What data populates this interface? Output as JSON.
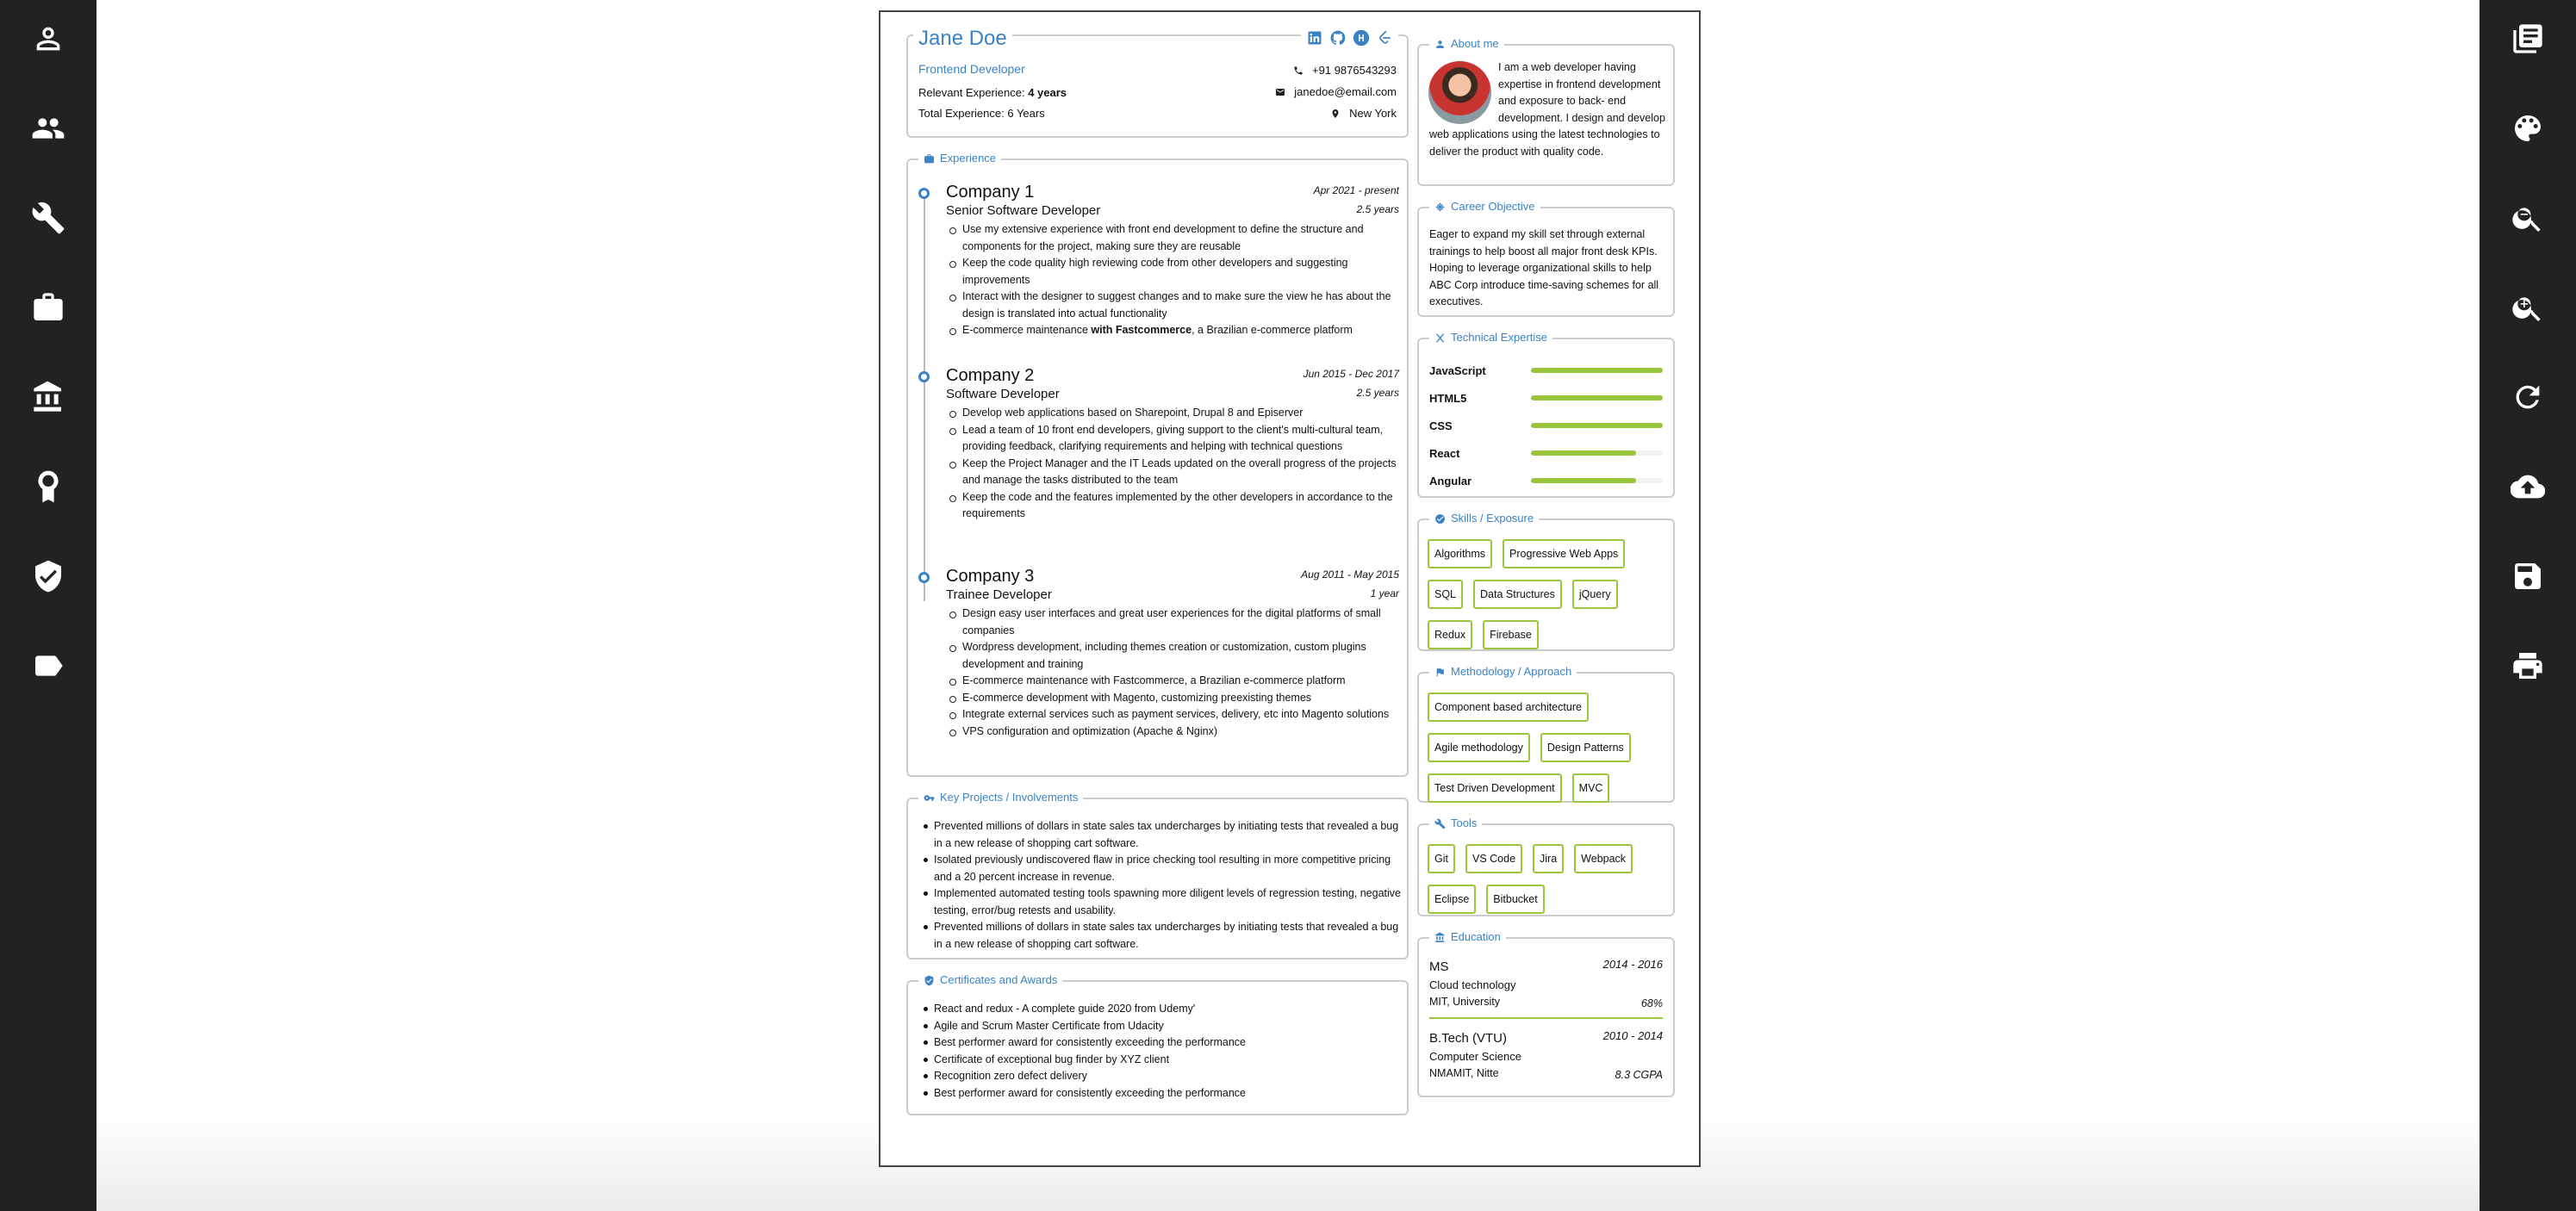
{
  "sidebar_left": {
    "items": [
      "person-icon",
      "people-icon",
      "wrench-icon",
      "briefcase-icon",
      "bank-icon",
      "award-icon",
      "shield-icon",
      "tag-icon"
    ]
  },
  "sidebar_right": {
    "items": [
      "library-icon",
      "palette-icon",
      "zoom-out-icon",
      "zoom-in-icon",
      "refresh-icon",
      "cloud-upload-icon",
      "save-icon",
      "print-icon"
    ]
  },
  "header": {
    "name": "Jane Doe",
    "role": "Frontend Developer",
    "relevant_label": "Relevant Experience: ",
    "relevant_value": "4 years",
    "total": "Total Experience: 6 Years",
    "phone": "+91 9876543293",
    "email": "janedoe@email.com",
    "location": "New York",
    "social": [
      "linkedin-icon",
      "github-icon",
      "hackerrank-icon",
      "leetcode-icon"
    ]
  },
  "experience": {
    "title": "Experience",
    "companies": [
      {
        "name": "Company 1",
        "position": "Senior Software Developer",
        "date": "Apr 2021 - present",
        "duration": "2.5 years",
        "points": [
          "Use my extensive experience with front end development to define the structure and components for the project, making sure they are reusable",
          "Keep the code quality high reviewing code from other developers and suggesting improvements",
          "Interact with the designer to suggest changes and to make sure the view he has about the design is translated into actual functionality"
        ],
        "last_pre": "E-commerce maintenance ",
        "last_bold": "with Fastcommerce",
        "last_post": ", a Brazilian e-commerce platform"
      },
      {
        "name": "Company 2",
        "position": "Software Developer",
        "date": "Jun 2015 - Dec 2017",
        "duration": "2.5 years",
        "points": [
          "Develop web applications based on Sharepoint, Drupal 8 and Episerver",
          "Lead a team of 10 front end developers, giving support to the client's multi-cultural team, providing feedback, clarifying requirements and helping with technical questions",
          "Keep the Project Manager and the IT Leads updated on the overall progress of the projects and manage the tasks distributed to the team",
          "Keep the code and the features implemented by the other developers in accordance to the requirements"
        ]
      },
      {
        "name": "Company 3",
        "position": "Trainee Developer",
        "date": "Aug 2011 - May 2015",
        "duration": "1 year",
        "points": [
          "Design easy user interfaces and great user experiences for the digital platforms of small companies",
          "Wordpress development, including themes creation or customization, custom plugins development and training",
          "E-commerce maintenance with Fastcommerce, a Brazilian e-commerce platform",
          "E-commerce development with Magento, customizing preexisting themes",
          "Integrate external services such as payment services, delivery, etc into Magento solutions",
          "VPS configuration and optimization (Apache & Nginx)"
        ]
      }
    ]
  },
  "projects": {
    "title": "Key Projects / Involvements",
    "items": [
      "Prevented millions of dollars in state sales tax undercharges by initiating tests that revealed a bug in a new release of shopping cart software.",
      "Isolated previously undiscovered flaw in price checking tool resulting in more competitive pricing and a 20 percent increase in revenue.",
      "Implemented automated testing tools spawning more diligent levels of regression testing, negative testing, error/bug retests and usability.",
      "Prevented millions of dollars in state sales tax undercharges by initiating tests that revealed a bug in a new release of shopping cart software."
    ]
  },
  "certificates": {
    "title": "Certificates and Awards",
    "items": [
      "React and redux - A complete guide 2020 from Udemy'",
      "Agile and Scrum Master Certificate from Udacity",
      "Best performer award for consistently exceeding the performance",
      "Certificate of exceptional bug finder by XYZ client",
      "Recognition zero defect delivery",
      "Best performer award for consistently exceeding the performance"
    ]
  },
  "about": {
    "title": "About me",
    "text": "I am a web developer having expertise in frontend development and exposure to back- end development. I design and develop web applications using the latest technologies to deliver the product with quality code."
  },
  "objective": {
    "title": "Career Objective",
    "text": "Eager to expand my skill set through external trainings to help boost all major front desk KPIs. Hoping to leverage organizational skills to help ABC Corp introduce time-saving schemes for all executives."
  },
  "technical": {
    "title": "Technical Expertise",
    "skills": [
      {
        "name": "JavaScript",
        "level": 1.0
      },
      {
        "name": "HTML5",
        "level": 1.0
      },
      {
        "name": "CSS",
        "level": 1.0
      },
      {
        "name": "React",
        "level": 0.8
      },
      {
        "name": "Angular",
        "level": 0.8
      }
    ],
    "bar_color": "#9bc53d"
  },
  "skills": {
    "title": "Skills / Exposure",
    "tags": [
      "Algorithms",
      "Progressive Web Apps",
      "SQL",
      "Data Structures",
      "jQuery",
      "Redux",
      "Firebase"
    ]
  },
  "methodology": {
    "title": "Methodology / Approach",
    "tags": [
      "Component based architecture",
      "Agile methodology",
      "Design Patterns",
      "Test Driven Development",
      "MVC"
    ]
  },
  "tools": {
    "title": "Tools",
    "tags": [
      "Git",
      "VS Code",
      "Jira",
      "Webpack",
      "Eclipse",
      "Bitbucket"
    ]
  },
  "education": {
    "title": "Education",
    "items": [
      {
        "degree": "MS",
        "years": "2014 - 2016",
        "field": "Cloud technology",
        "university": "MIT, University",
        "score": "68%"
      },
      {
        "degree": "B.Tech (VTU)",
        "years": "2010 - 2014",
        "field": "Computer Science",
        "university": "NMAMIT, Nitte",
        "score": "8.3 CGPA"
      }
    ]
  },
  "colors": {
    "accent": "#3b82c4",
    "tag_border": "#9bc53d",
    "sidebar_bg": "#222222"
  }
}
